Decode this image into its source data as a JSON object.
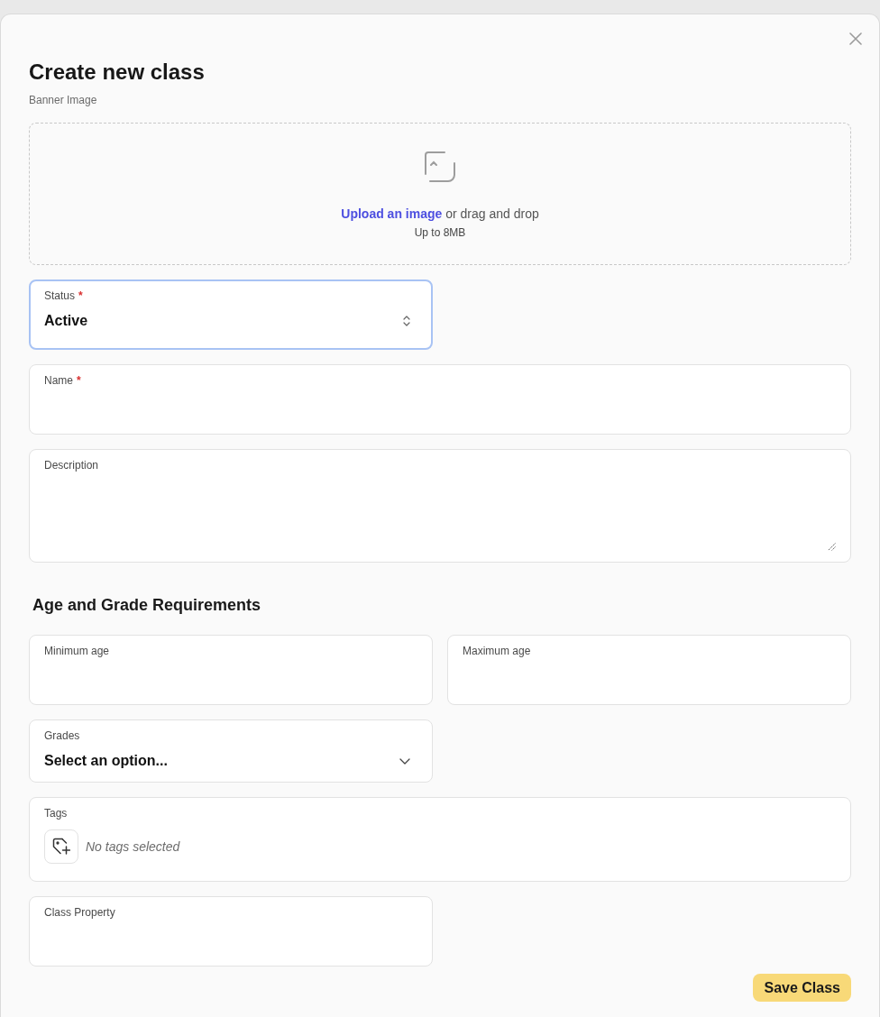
{
  "dialog": {
    "title": "Create new class"
  },
  "banner": {
    "label": "Banner Image",
    "link": "Upload an image",
    "text": "or drag and drop",
    "hint": "Up to 8MB"
  },
  "fields": [
    {
      "kind": "select",
      "label": "Status",
      "required_mark": "*",
      "value": "Active",
      "focused": true
    },
    {
      "kind": "input",
      "label": "Name",
      "required_mark": "*",
      "focused": false
    },
    {
      "kind": "textarea",
      "label": "Description",
      "focused": false
    }
  ],
  "age_and_grade": {
    "title": "Age and Grade Requirements",
    "fields": [
      {
        "kind": "input",
        "label": "Minimum age",
        "focused": false
      },
      {
        "kind": "input",
        "label": "Maximum age",
        "focused": false
      },
      {
        "kind": "dropdown",
        "label": "Grades",
        "value": "Select an option...",
        "focused": false
      },
      {
        "kind": "tags",
        "label": "Tags",
        "empty_text": "No tags selected",
        "focused": false
      },
      {
        "kind": "input",
        "label": "Class Property",
        "focused": false
      }
    ]
  },
  "save_button": {
    "label": "Save Class"
  }
}
